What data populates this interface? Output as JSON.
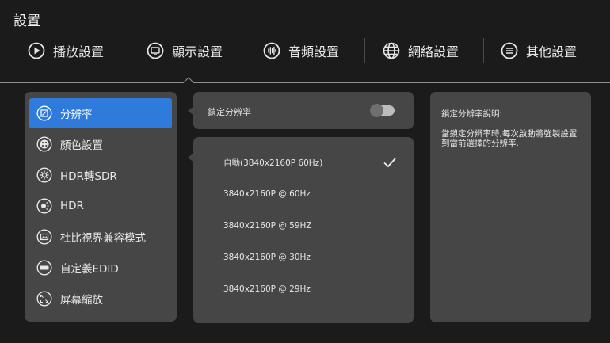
{
  "header": {
    "title": "設置"
  },
  "tabs": [
    {
      "label": "播放設置",
      "icon": "play-icon"
    },
    {
      "label": "顯示設置",
      "icon": "display-icon"
    },
    {
      "label": "音頻設置",
      "icon": "audio-icon"
    },
    {
      "label": "網絡設置",
      "icon": "globe-icon"
    },
    {
      "label": "其他設置",
      "icon": "menu-icon"
    }
  ],
  "active_tab": "顯示設置",
  "sidebar": {
    "items": [
      {
        "label": "分辨率",
        "icon": "resolution-icon",
        "active": true
      },
      {
        "label": "顏色設置",
        "icon": "palette-icon"
      },
      {
        "label": "HDR轉SDR",
        "icon": "hdr-to-sdr-icon"
      },
      {
        "label": "HDR",
        "icon": "hdr-icon"
      },
      {
        "label": "杜比視界兼容模式",
        "icon": "dolby-vision-icon"
      },
      {
        "label": "自定義EDID",
        "icon": "edid-icon"
      },
      {
        "label": "屏幕縮放",
        "icon": "screen-scale-icon"
      }
    ]
  },
  "lock": {
    "label": "鎖定分辨率",
    "enabled": false
  },
  "resolutions": {
    "items": [
      {
        "label": "自動(3840x2160P 60Hz)",
        "selected": true
      },
      {
        "label": "3840x2160P @ 60Hz"
      },
      {
        "label": "3840x2160P @ 59HZ"
      },
      {
        "label": "3840x2160P @ 30Hz"
      },
      {
        "label": "3840x2160P @ 29Hz"
      }
    ]
  },
  "description": {
    "title": "鎖定分辨率說明:",
    "body": "當鎖定分辨率時,每次啟動將強製設置到當前選擇的分辨率."
  },
  "colors": {
    "background": "#1b1b1b",
    "panel": "#464646",
    "accent": "#2e7bdc"
  }
}
